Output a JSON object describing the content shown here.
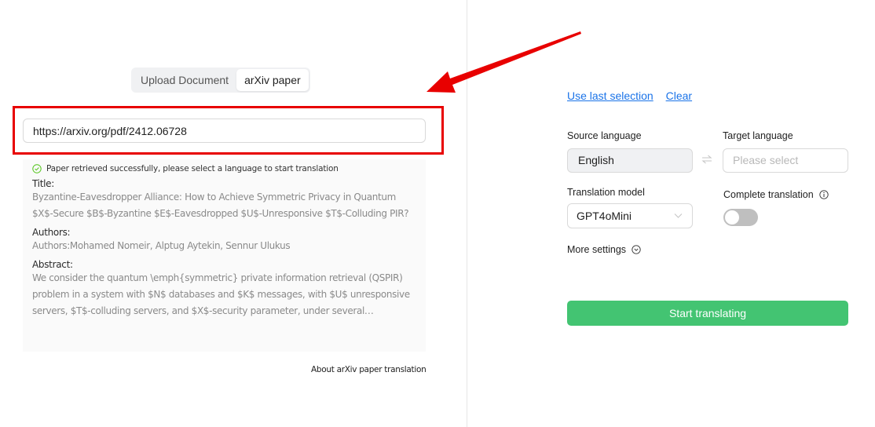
{
  "source_tabs": {
    "items": [
      {
        "label": "Upload Document",
        "active": false
      },
      {
        "label": "arXiv paper",
        "active": true
      }
    ]
  },
  "url_input": {
    "value": "https://arxiv.org/pdf/2412.06728"
  },
  "paper_info": {
    "status": "Paper retrieved successfully, please select a language to start translation",
    "title_label": "Title:",
    "title_line1": "Byzantine-Eavesdropper Alliance: How to Achieve Symmetric Privacy in Quantum",
    "title_line2": "$X$-Secure $B$-Byzantine $E$-Eavesdropped $U$-Unresponsive $T$-Colluding PIR?",
    "authors_label": "Authors:",
    "authors": "Authors:Mohamed Nomeir, Alptug Aytekin, Sennur Ulukus",
    "abstract_label": "Abstract:",
    "abstract_line1": "We consider the quantum \\emph{symmetric} private information retrieval (QSPIR)",
    "abstract_line2": "problem in a system with $N$ databases and $K$ messages, with $U$ unresponsive",
    "abstract_line3": "servers, $T$-colluding servers, and $X$-security parameter, under several…"
  },
  "about_link": "About arXiv paper translation",
  "settings": {
    "use_last_selection": "Use last selection",
    "clear": "Clear",
    "source_language_label": "Source language",
    "source_language_value": "English",
    "target_language_label": "Target language",
    "target_language_placeholder": "Please select",
    "translation_model_label": "Translation model",
    "translation_model_value": "GPT4oMini",
    "complete_translation_label": "Complete translation",
    "complete_translation_enabled": false,
    "more_settings": "More settings",
    "start_button": "Start translating"
  },
  "colors": {
    "accent_green": "#43c472",
    "link_blue": "#1a73e8",
    "annotation_red": "#e80000",
    "success_green": "#52c41a"
  }
}
